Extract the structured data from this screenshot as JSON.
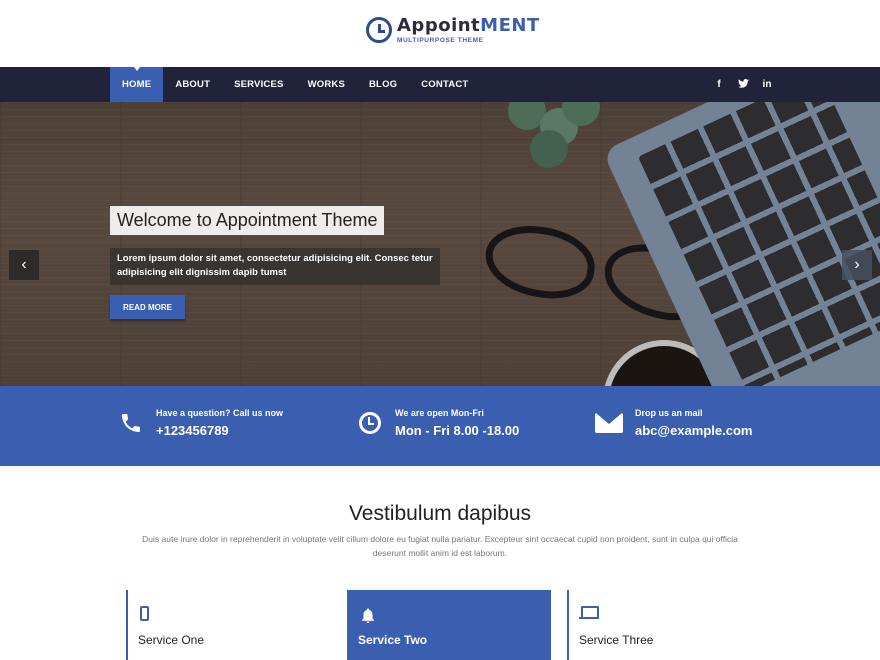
{
  "brand": {
    "name_part1": "Appoint",
    "name_part2": "ment",
    "tagline": "MULTIPURPOSE THEME"
  },
  "nav": {
    "items": [
      {
        "label": "HOME",
        "active": true
      },
      {
        "label": "ABOUT",
        "active": false
      },
      {
        "label": "SERVICES",
        "active": false
      },
      {
        "label": "WORKS",
        "active": false
      },
      {
        "label": "BLOG",
        "active": false
      },
      {
        "label": "CONTACT",
        "active": false
      }
    ],
    "social": [
      "f",
      "t",
      "in"
    ]
  },
  "hero": {
    "title": "Welcome to Appointment Theme",
    "text": "Lorem ipsum dolor sit amet, consectetur adipisicing elit. Consec tetur adipisicing elit dignissim dapib tumst",
    "button": "READ MORE",
    "prev": "‹",
    "next": "›"
  },
  "contact": {
    "phone": {
      "label": "Have a question? Call us now",
      "value": "+123456789"
    },
    "hours": {
      "label": "We are open Mon-Fri",
      "value": "Mon - Fri 8.00 -18.00"
    },
    "mail": {
      "label": "Drop us an mail",
      "value": "abc@example.com"
    }
  },
  "services_section": {
    "title": "Vestibulum dapibus",
    "description": "Duis aute irure dolor in reprehenderit in voluptate velit cillum dolore eu fugiat nulla pariatur. Excepteur sint occaecat cupid non proident, sunt in culpa qui officia deserunt mollit anim id est laborum.",
    "items": [
      {
        "title": "Service One",
        "icon": "mobile-icon"
      },
      {
        "title": "Service Two",
        "icon": "bell-icon"
      },
      {
        "title": "Service Three",
        "icon": "laptop-icon"
      }
    ]
  },
  "colors": {
    "accent": "#3a5fb0",
    "nav_bg": "#21233a"
  }
}
